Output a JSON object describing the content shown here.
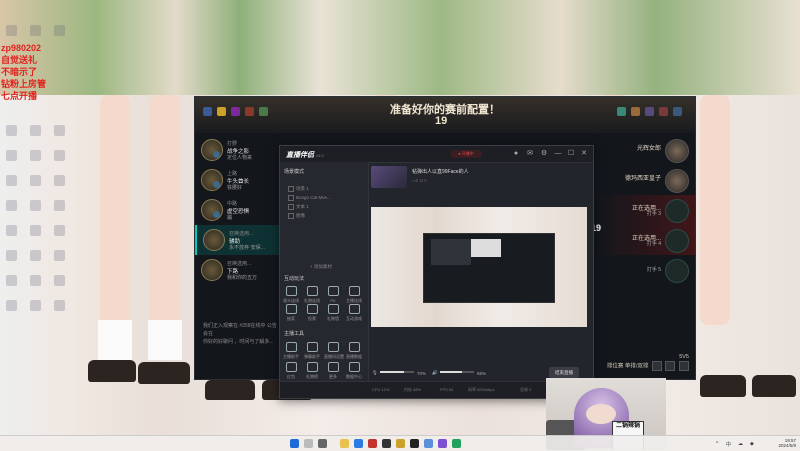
{
  "overlay": {
    "lines": [
      "zp980202",
      "自觉送礼",
      "不暗示了",
      "钻粉上房管",
      "七点开播"
    ],
    "color": "#e0231e"
  },
  "lol": {
    "title": "准备好你的赛前配置！",
    "timer": "19",
    "right_timer": "19",
    "left_team": [
      {
        "pos": "打野",
        "role": "战争之影",
        "sub": "定位人物来"
      },
      {
        "pos": "上路",
        "role": "牛头酋长",
        "sub": "铁腰好"
      },
      {
        "pos": "中路",
        "role": "虚空恐惧",
        "sub": "蹦"
      },
      {
        "pos": "召唤选用...",
        "role": "辅助",
        "sub": "永不放弃·安保..."
      },
      {
        "pos": "召唤选用...",
        "role": "下路",
        "sub": "我和你的五万"
      }
    ],
    "right_team": [
      {
        "name": "光辉女郎",
        "sub": ""
      },
      {
        "name": "德玛西亚皇子",
        "sub": ""
      },
      {
        "name": "正在选用...",
        "sub": "打手 3"
      },
      {
        "name": "正在选用...",
        "sub": "打手 4"
      },
      {
        "name": "",
        "sub": "打手 5"
      }
    ],
    "chat": [
      "我们正入观察在 #358在线中 公告会在",
      "你好的好聊问 ，时间与了解多..."
    ],
    "bottom": {
      "mode": "5V5",
      "queue": "排位赛 单排/双排"
    }
  },
  "app": {
    "name": "直播伴侣",
    "version": "v1.0",
    "live_label": "● 开播中",
    "scene_section": "场景模式",
    "scene_name": "帖弹出人以直99Face的人",
    "scene_sub": "♪ ⊙ ☐ ≡",
    "sources": [
      "场景 1",
      "Bongo Cat Mve...",
      "文本 1",
      "图像"
    ],
    "add_source": "+ 添加素材",
    "interact_section": "互动玩法",
    "interact_items": [
      "观众连线",
      "礼物连线",
      "PK",
      "主播连线",
      "抽奖",
      "投票",
      "礼物墙",
      "互动游戏"
    ],
    "tools_section": "主播工具",
    "tool_items": [
      "主播助手",
      "弹幕助手",
      "直播间设置",
      "直播数据",
      "红包",
      "礼物榜",
      "更多",
      "数据中心"
    ],
    "mic_pct": "70%",
    "sys_pct": "65%",
    "start_label": "结束直播",
    "status_bar": [
      "CPU 12%",
      "内存 48%",
      "FPS 60",
      "码率 6000kbps",
      "丢帧 0"
    ]
  },
  "taskbar": {
    "time": "19:57",
    "date": "2024/5/8",
    "tray": [
      "^",
      "中",
      "☁",
      "◆"
    ]
  },
  "cam": {
    "sign": "二锅辣锅"
  }
}
